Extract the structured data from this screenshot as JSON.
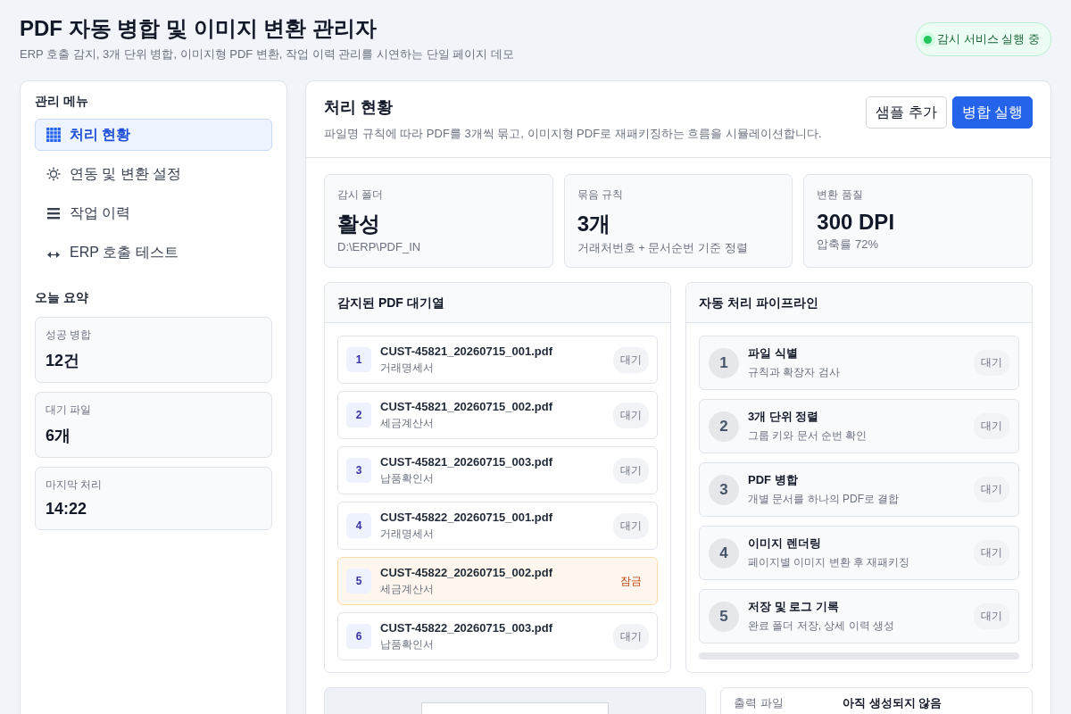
{
  "header": {
    "title": "PDF 자동 병합 및 이미지 변환 관리자",
    "subtitle": "ERP 호출 감지, 3개 단위 병합, 이미지형 PDF 변환, 작업 이력 관리를 시연하는 단일 페이지 데모",
    "service_status": {
      "label": "감시 서비스 실행 중",
      "on": true
    }
  },
  "sidebar": {
    "title": "관리 메뉴",
    "items": [
      {
        "label": "처리 현황",
        "selected": true
      },
      {
        "label": "연동 및 변환 설정",
        "selected": false
      },
      {
        "label": "작업 이력",
        "selected": false
      },
      {
        "label": "ERP 호출 테스트",
        "selected": false
      }
    ],
    "summary_title": "오늘 요약",
    "summary": [
      {
        "label": "성공 병합",
        "value": "12건"
      },
      {
        "label": "대기 파일",
        "value": "6개"
      },
      {
        "label": "마지막 처리",
        "value": "14:22"
      }
    ]
  },
  "main": {
    "title": "처리 현황",
    "description": "파일명 규칙에 따라 PDF를 3개씩 묶고, 이미지형 PDF로 재패키징하는 흐름을 시뮬레이션합니다.",
    "buttons": [
      {
        "label": "샘플 추가",
        "kind": "secondary"
      },
      {
        "label": "병합 실행",
        "kind": "primary"
      }
    ],
    "stats": [
      {
        "label": "감시 폴더",
        "value": "활성",
        "note": "D:\\ERP\\PDF_IN"
      },
      {
        "label": "묶음 규칙",
        "value": "3개",
        "note": "거래처번호 + 문서순번 기준 정렬"
      },
      {
        "label": "변환 품질",
        "value": "300 DPI",
        "note": "압축률 72%"
      }
    ],
    "queue": {
      "title": "감지된 PDF 대기열",
      "items": [
        {
          "index": "1",
          "file": "CUST-45821_20260715_001.pdf",
          "doc": "거래명세서",
          "status": "대기",
          "kind": "waiting"
        },
        {
          "index": "2",
          "file": "CUST-45821_20260715_002.pdf",
          "doc": "세금계산서",
          "status": "대기",
          "kind": "waiting"
        },
        {
          "index": "3",
          "file": "CUST-45821_20260715_003.pdf",
          "doc": "납품확인서",
          "status": "대기",
          "kind": "waiting"
        },
        {
          "index": "4",
          "file": "CUST-45822_20260715_001.pdf",
          "doc": "거래명세서",
          "status": "대기",
          "kind": "waiting"
        },
        {
          "index": "5",
          "file": "CUST-45822_20260715_002.pdf",
          "doc": "세금계산서",
          "status": "잠금",
          "kind": "locked"
        },
        {
          "index": "6",
          "file": "CUST-45822_20260715_003.pdf",
          "doc": "납품확인서",
          "status": "대기",
          "kind": "waiting"
        }
      ]
    },
    "pipeline": {
      "title": "자동 처리 파이프라인",
      "steps": [
        {
          "number": "1",
          "title": "파일 식별",
          "desc": "규칙과 확장자 검사",
          "status": "대기"
        },
        {
          "number": "2",
          "title": "3개 단위 정렬",
          "desc": "그룹 키와 문서 순번 확인",
          "status": "대기"
        },
        {
          "number": "3",
          "title": "PDF 병합",
          "desc": "개별 문서를 하나의 PDF로 결합",
          "status": "대기"
        },
        {
          "number": "4",
          "title": "이미지 렌더링",
          "desc": "페이지별 이미지 변환 후 재패키징",
          "status": "대기"
        },
        {
          "number": "5",
          "title": "저장 및 로그 기록",
          "desc": "완료 폴더 저장, 상세 이력 생성",
          "status": "대기"
        }
      ],
      "progress": {
        "level": 0
      }
    },
    "output": {
      "label": "출력 파일",
      "value": "아직 생성되지 않음"
    }
  }
}
